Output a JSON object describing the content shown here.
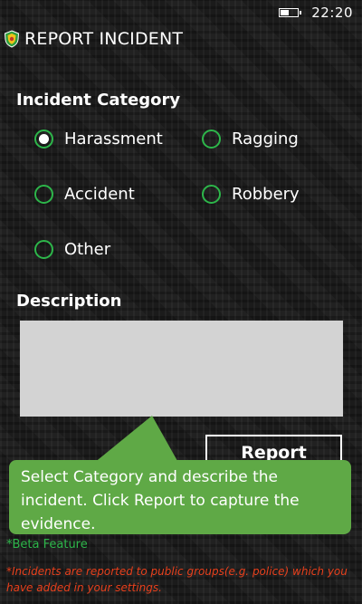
{
  "status_bar": {
    "time": "22:20",
    "battery_level": 0.45
  },
  "app": {
    "title": "REPORT INCIDENT",
    "icon": "shield-icon"
  },
  "category": {
    "label": "Incident Category",
    "options": [
      {
        "label": "Harassment",
        "selected": true
      },
      {
        "label": "Ragging",
        "selected": false
      },
      {
        "label": "Accident",
        "selected": false
      },
      {
        "label": "Robbery",
        "selected": false
      },
      {
        "label": "Other",
        "selected": false
      }
    ]
  },
  "description": {
    "label": "Description",
    "value": ""
  },
  "report_button": {
    "label": "Report"
  },
  "tooltip": {
    "text": "Select Category and describe the incident. Click Report to capture the evidence."
  },
  "footer": {
    "beta_note": "*Beta Feature",
    "disclaimer": "*Incidents are reported to public groups(e.g. police) which you have added in your settings."
  },
  "colors": {
    "accent_green": "#2db64a",
    "tooltip_green": "#5fa946",
    "warning_red": "#e8401c"
  }
}
